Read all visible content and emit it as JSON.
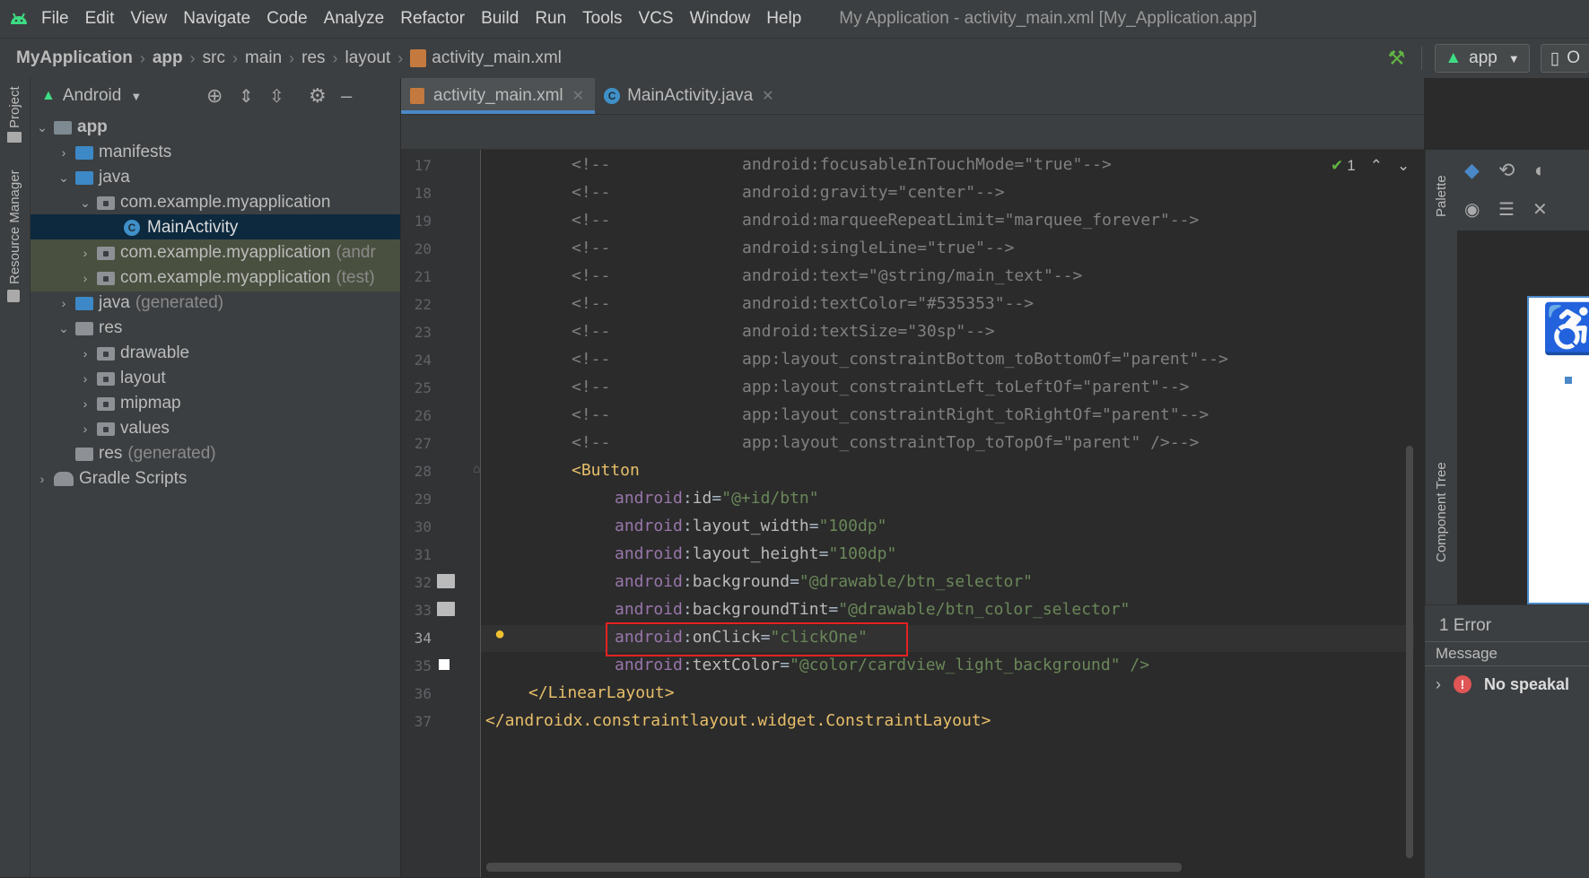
{
  "menu": {
    "items": [
      "File",
      "Edit",
      "View",
      "Navigate",
      "Code",
      "Analyze",
      "Refactor",
      "Build",
      "Run",
      "Tools",
      "VCS",
      "Window",
      "Help"
    ],
    "window_title": "My Application - activity_main.xml [My_Application.app]"
  },
  "breadcrumb": {
    "items": [
      "MyApplication",
      "app",
      "src",
      "main",
      "res",
      "layout",
      "activity_main.xml"
    ],
    "run_config": "app",
    "device_partial": "O"
  },
  "tool_windows": {
    "project": "Project",
    "resource_manager": "Resource Manager",
    "palette": "Palette",
    "component_tree": "Component Tree"
  },
  "project_panel": {
    "view_selector": "Android",
    "tree": [
      {
        "label": "app",
        "note": ""
      },
      {
        "label": "manifests",
        "note": ""
      },
      {
        "label": "java",
        "note": ""
      },
      {
        "label": "com.example.myapplication",
        "note": ""
      },
      {
        "label": "MainActivity",
        "note": ""
      },
      {
        "label": "com.example.myapplication",
        "note": "(andr"
      },
      {
        "label": "com.example.myapplication",
        "note": "(test)"
      },
      {
        "label": "java",
        "note": "(generated)"
      },
      {
        "label": "res",
        "note": ""
      },
      {
        "label": "drawable",
        "note": ""
      },
      {
        "label": "layout",
        "note": ""
      },
      {
        "label": "mipmap",
        "note": ""
      },
      {
        "label": "values",
        "note": ""
      },
      {
        "label": "res",
        "note": "(generated)"
      },
      {
        "label": "Gradle Scripts",
        "note": ""
      }
    ]
  },
  "editor": {
    "tabs": [
      {
        "label": "activity_main.xml",
        "active": true
      },
      {
        "label": "MainActivity.java",
        "active": false
      }
    ],
    "inspection_count": "1",
    "lines": [
      {
        "n": "17",
        "pre": "        <!--             ",
        "attr": "android:focusableInTouchMode=\"true\"-->"
      },
      {
        "n": "18",
        "pre": "        <!--             ",
        "attr": "android:gravity=\"center\"-->"
      },
      {
        "n": "19",
        "pre": "        <!--             ",
        "attr": "android:marqueeRepeatLimit=\"marquee_forever\"-->"
      },
      {
        "n": "20",
        "pre": "        <!--             ",
        "attr": "android:singleLine=\"true\"-->"
      },
      {
        "n": "21",
        "pre": "        <!--             ",
        "attr": "android:text=\"@string/main_text\"-->"
      },
      {
        "n": "22",
        "pre": "        <!--             ",
        "attr": "android:textColor=\"#535353\"-->"
      },
      {
        "n": "23",
        "pre": "        <!--             ",
        "attr": "android:textSize=\"30sp\"-->"
      },
      {
        "n": "24",
        "pre": "        <!--             ",
        "attr": "app:layout_constraintBottom_toBottomOf=\"parent\"-->"
      },
      {
        "n": "25",
        "pre": "        <!--             ",
        "attr": "app:layout_constraintLeft_toLeftOf=\"parent\"-->"
      },
      {
        "n": "26",
        "pre": "        <!--             ",
        "attr": "app:layout_constraintRight_toRightOf=\"parent\"-->"
      },
      {
        "n": "27",
        "pre": "        <!--             ",
        "attr": "app:layout_constraintTop_toTopOf=\"parent\" />-->"
      }
    ],
    "button_tag": "<Button",
    "button_attrs": [
      {
        "n": "29",
        "ns": "android",
        "name": "id",
        "value": "\"@+id/btn\""
      },
      {
        "n": "30",
        "ns": "android",
        "name": "layout_width",
        "value": "\"100dp\""
      },
      {
        "n": "31",
        "ns": "android",
        "name": "layout_height",
        "value": "\"100dp\""
      },
      {
        "n": "32",
        "ns": "android",
        "name": "background",
        "value": "\"@drawable/btn_selector\""
      },
      {
        "n": "33",
        "ns": "android",
        "name": "backgroundTint",
        "value": "\"@drawable/btn_color_selector\""
      },
      {
        "n": "34",
        "ns": "android",
        "name": "onClick",
        "value": "\"clickOne\""
      },
      {
        "n": "35",
        "ns": "android",
        "name": "textColor",
        "value": "\"@color/cardview_light_background\" />"
      }
    ],
    "line28": "28",
    "line36": "36",
    "line37": "37",
    "close_linear": "</LinearLayout>",
    "close_constraint": "</androidx.constraintlayout.widget.ConstraintLayout>"
  },
  "problems": {
    "summary": "1 Error",
    "column": "Message",
    "first": "No speakal"
  },
  "colors": {
    "accent": "#4a88c7",
    "highlight_box": "#e52222",
    "error": "#e05555"
  }
}
